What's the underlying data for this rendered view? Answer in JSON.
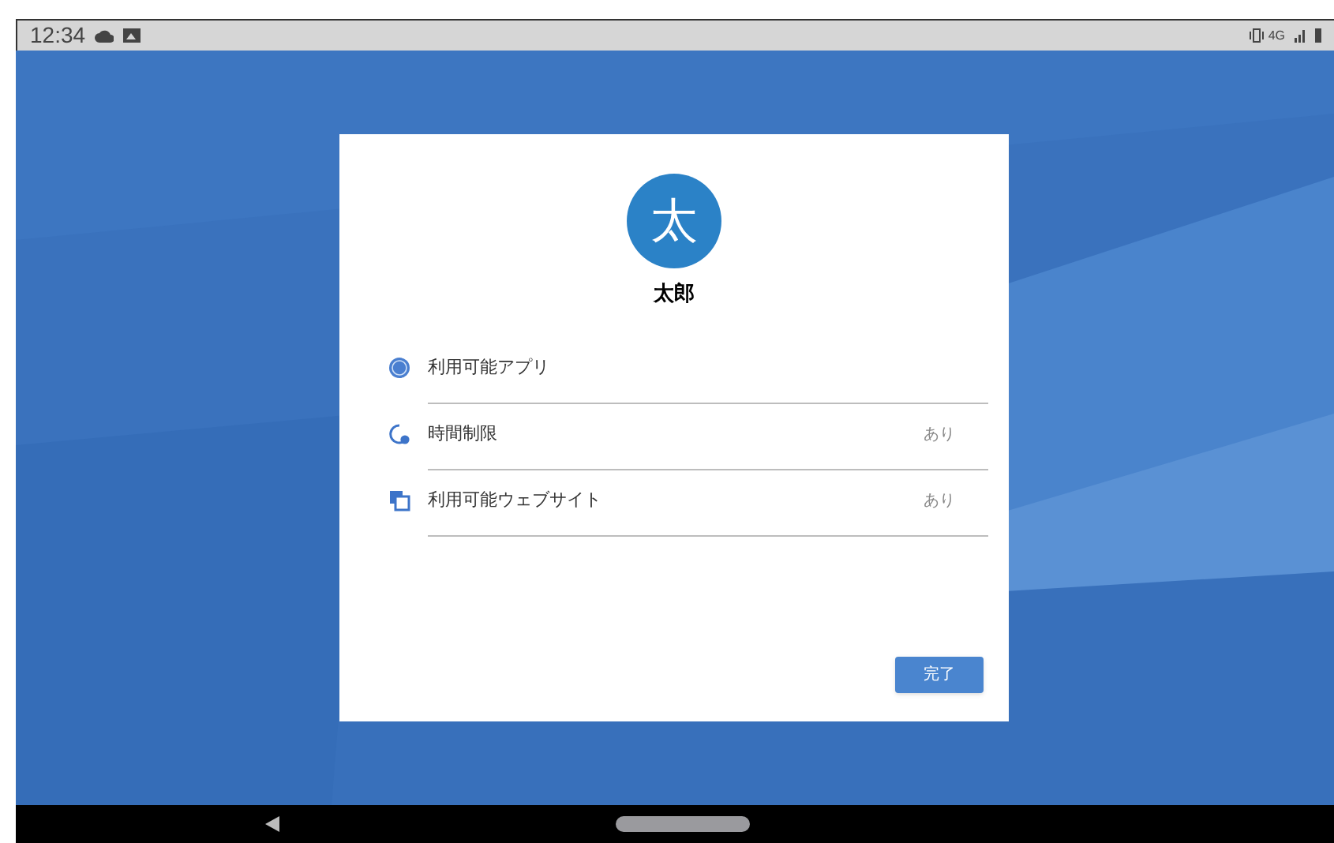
{
  "status_bar": {
    "time": "12:34",
    "network": "4G"
  },
  "dialog": {
    "avatar": "太",
    "name": "太郎",
    "rows": [
      {
        "kind": "apps",
        "label": "利用可能アプリ"
      },
      {
        "kind": "time",
        "label": "時間制限",
        "value": "あり"
      },
      {
        "kind": "websites",
        "label": "利用可能ウェブサイト",
        "value": "あり"
      }
    ],
    "button": "完了"
  }
}
